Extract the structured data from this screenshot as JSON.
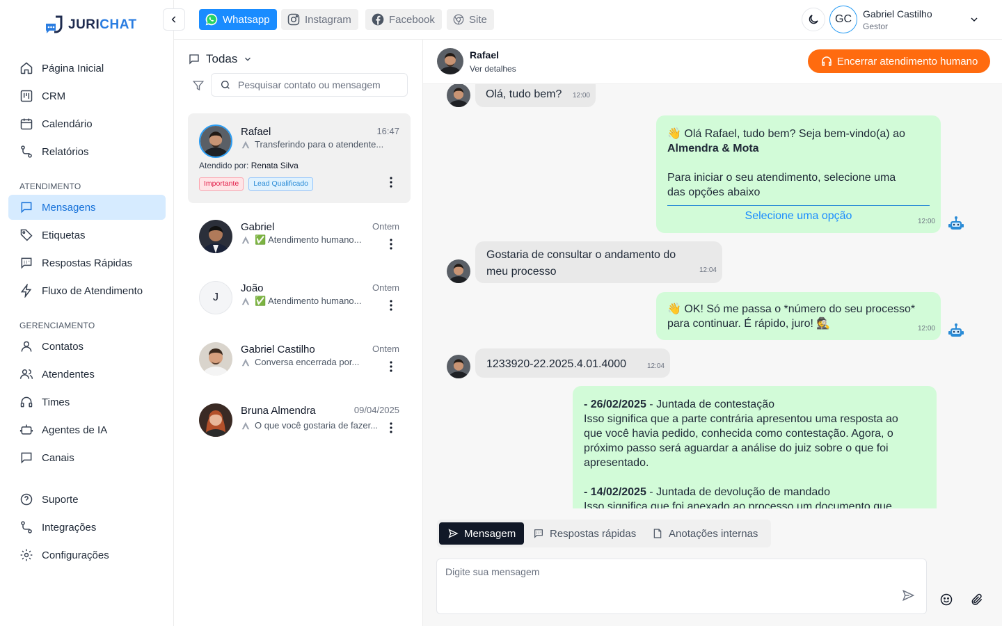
{
  "brand": {
    "name_main": "JURI",
    "name_accent": "CHAT"
  },
  "sidebar": {
    "items_main": [
      {
        "label": "Página Inicial",
        "icon": "home-icon"
      },
      {
        "label": "CRM",
        "icon": "crm-board-icon"
      },
      {
        "label": "Calendário",
        "icon": "calendar-icon"
      },
      {
        "label": "Relatórios",
        "icon": "route-icon"
      }
    ],
    "section_atendimento": "ATENDIMENTO",
    "items_atendimento": [
      {
        "label": "Mensagens",
        "icon": "message-icon",
        "active": true
      },
      {
        "label": "Etiquetas",
        "icon": "tag-icon"
      },
      {
        "label": "Respostas Rápidas",
        "icon": "quick-reply-icon"
      },
      {
        "label": "Fluxo de Atendimento",
        "icon": "lightning-icon"
      }
    ],
    "section_gerenciamento": "GERENCIAMENTO",
    "items_gerenciamento": [
      {
        "label": "Contatos",
        "icon": "user-icon"
      },
      {
        "label": "Atendentes",
        "icon": "users-icon"
      },
      {
        "label": "Times",
        "icon": "headset-icon"
      },
      {
        "label": "Agentes de IA",
        "icon": "bot-icon"
      },
      {
        "label": "Canais",
        "icon": "channel-icon"
      }
    ],
    "items_footer": [
      {
        "label": "Suporte",
        "icon": "help-icon"
      },
      {
        "label": "Integrações",
        "icon": "route-icon"
      },
      {
        "label": "Configurações",
        "icon": "gear-icon"
      }
    ]
  },
  "topbar": {
    "channels": [
      {
        "label": "Whatsapp",
        "icon": "whatsapp-icon",
        "active": true
      },
      {
        "label": "Instagram",
        "icon": "instagram-icon"
      },
      {
        "label": "Facebook",
        "icon": "facebook-icon"
      },
      {
        "label": "Site",
        "icon": "chrome-icon"
      }
    ],
    "user": {
      "initials": "GC",
      "name": "Gabriel Castilho",
      "role": "Gestor"
    }
  },
  "conversations": {
    "filter_label": "Todas",
    "search_placeholder": "Pesquisar contato ou mensagem",
    "items": [
      {
        "name": "Rafael",
        "time": "16:47",
        "preview": "Transferindo para o atendente...",
        "attended_label": "Atendido por:",
        "attended_by": "Renata Silva",
        "tags": [
          {
            "label": "Importante",
            "color": "#e11d48",
            "bg": "#ffe4e6"
          },
          {
            "label": "Lead Qualificado",
            "color": "#2a8bd6",
            "bg": "#e0f2fe"
          }
        ]
      },
      {
        "name": "Gabriel",
        "time": "Ontem",
        "preview": "✅ Atendimento humano..."
      },
      {
        "name": "João",
        "initial": "J",
        "time": "Ontem",
        "preview": "✅ Atendimento humano..."
      },
      {
        "name": "Gabriel Castilho",
        "time": "Ontem",
        "preview": "Conversa encerrada por..."
      },
      {
        "name": "Bruna Almendra",
        "time": "09/04/2025",
        "preview": "O que você gostaria de fazer..."
      }
    ]
  },
  "chat": {
    "contact_name": "Rafael",
    "contact_details": "Ver detalhes",
    "end_button": "Encerrar atendimento humano",
    "messages": {
      "m1": {
        "text": "Olá, tudo bem?",
        "time": "12:00"
      },
      "m2": {
        "line1": "👋 Olá Rafael, tudo bem? Seja bem-vindo(a) ao",
        "bold": "Almendra & Mota",
        "line3": "Para iniciar o seu atendimento, selecione uma",
        "line4": "das opções abaixo",
        "option": "Selecione uma opção",
        "time": "12:00"
      },
      "m3": {
        "line1": "Gostaria de consultar o andamento do",
        "line2": "meu processo",
        "time": "12:04"
      },
      "m4": {
        "line1": "👋 OK! Só me passa o *número do seu processo*",
        "line2": "para continuar. É rápido, juro! 🕵️",
        "time": "12:00"
      },
      "m5": {
        "text": "1233920-22.2025.4.01.4000",
        "time": "12:04"
      },
      "m6": {
        "d1": "- 26/02/2025",
        "t1": " - Juntada de contestação",
        "p1": "Isso significa que a parte contrária apresentou uma resposta ao",
        "p2": "que você havia pedido, conhecida como contestação. Agora, o",
        "p3": "próximo passo será aguardar a análise do juiz sobre o que foi",
        "p4": "apresentado.",
        "d2": "- 14/02/2025",
        "t2": " - Juntada de devolução de mandado",
        "p5": "Isso significa que foi anexado ao processo um documento que"
      }
    },
    "composer_tabs": [
      {
        "label": "Mensagem",
        "icon": "send-icon",
        "active": true
      },
      {
        "label": "Respostas rápidas",
        "icon": "quick-reply-icon"
      },
      {
        "label": "Anotações internas",
        "icon": "note-icon"
      }
    ],
    "composer_placeholder": "Digite sua mensagem"
  },
  "colors": {
    "accent": "#1a8cff",
    "active_bg": "#d6ebff",
    "orange": "#ff6b0f",
    "bubble_out": "#d2fbd8",
    "bubble_in": "#e9e9e9"
  }
}
